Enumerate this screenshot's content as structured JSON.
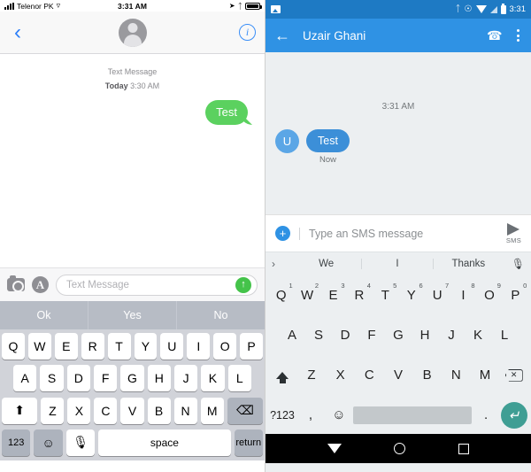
{
  "ios": {
    "status": {
      "carrier": "Telenor PK",
      "time": "3:31 AM",
      "icons": [
        "signal-bars-icon",
        "wifi-icon",
        "location-arrow-icon",
        "bluetooth-icon",
        "battery-icon"
      ]
    },
    "nav": {
      "back": "back-chevron-icon",
      "avatar": "contact-avatar",
      "info": "i"
    },
    "thread": {
      "header_label": "Text Message",
      "header_day": "Today",
      "header_time": "3:30 AM",
      "messages": [
        {
          "text": "Test",
          "side": "outgoing",
          "type": "sms"
        }
      ]
    },
    "input": {
      "camera": "camera-icon",
      "appstore": "A",
      "placeholder": "Text Message",
      "send": "send-arrow-icon"
    },
    "predictive": [
      "Ok",
      "Yes",
      "No"
    ],
    "keyboard": {
      "row1": [
        "Q",
        "W",
        "E",
        "R",
        "T",
        "Y",
        "U",
        "I",
        "O",
        "P"
      ],
      "row2": [
        "A",
        "S",
        "D",
        "F",
        "G",
        "H",
        "J",
        "K",
        "L"
      ],
      "row3": [
        "Z",
        "X",
        "C",
        "V",
        "B",
        "N",
        "M"
      ],
      "shift": "shift-icon",
      "backspace": "backspace-icon",
      "numbers": "123",
      "emoji": "emoji-icon",
      "mic": "mic-icon",
      "space": "space",
      "return": "return"
    },
    "colors": {
      "bubble_green": "#5bd15f",
      "accent_blue": "#2d7ff9",
      "keyboard_bg": "#d1d3d9"
    }
  },
  "android": {
    "status": {
      "time": "3:31",
      "icons": [
        "screenshot-icon",
        "bluetooth-icon",
        "vibrate-icon",
        "wifi-icon",
        "signal-icon",
        "battery-icon"
      ]
    },
    "appbar": {
      "back": "back-arrow-icon",
      "title": "Uzair Ghani",
      "call": "phone-icon",
      "overflow": "overflow-menu-icon"
    },
    "thread": {
      "time_divider": "3:31 AM",
      "messages": [
        {
          "avatar": "U",
          "text": "Test",
          "status": "Now"
        }
      ]
    },
    "input": {
      "attach": "+",
      "placeholder": "Type an SMS message",
      "send_icon": "send-arrow-icon",
      "send_label": "SMS"
    },
    "suggestions": {
      "expand": "›",
      "items": [
        "We",
        "I",
        "Thanks"
      ],
      "mic": "mic-icon"
    },
    "keyboard": {
      "row1": [
        {
          "k": "Q",
          "n": "1"
        },
        {
          "k": "W",
          "n": "2"
        },
        {
          "k": "E",
          "n": "3"
        },
        {
          "k": "R",
          "n": "4"
        },
        {
          "k": "T",
          "n": "5"
        },
        {
          "k": "Y",
          "n": "6"
        },
        {
          "k": "U",
          "n": "7"
        },
        {
          "k": "I",
          "n": "8"
        },
        {
          "k": "O",
          "n": "9"
        },
        {
          "k": "P",
          "n": "0"
        }
      ],
      "row2": [
        "A",
        "S",
        "D",
        "F",
        "G",
        "H",
        "J",
        "K",
        "L"
      ],
      "row3": [
        "Z",
        "X",
        "C",
        "V",
        "B",
        "N",
        "M"
      ],
      "shift": "shift-icon",
      "backspace": "backspace-icon",
      "symbols": "?123",
      "comma": ",",
      "emoji": "emoji-icon",
      "period": ".",
      "enter": "enter-icon"
    },
    "navbar": {
      "back": "nav-back-icon",
      "home": "nav-home-icon",
      "recents": "nav-recents-icon"
    },
    "colors": {
      "appbar_blue": "#2f92e4",
      "status_blue": "#1e7ac4",
      "bubble_blue": "#3c8fd8",
      "enter_teal": "#3f9e94"
    }
  }
}
